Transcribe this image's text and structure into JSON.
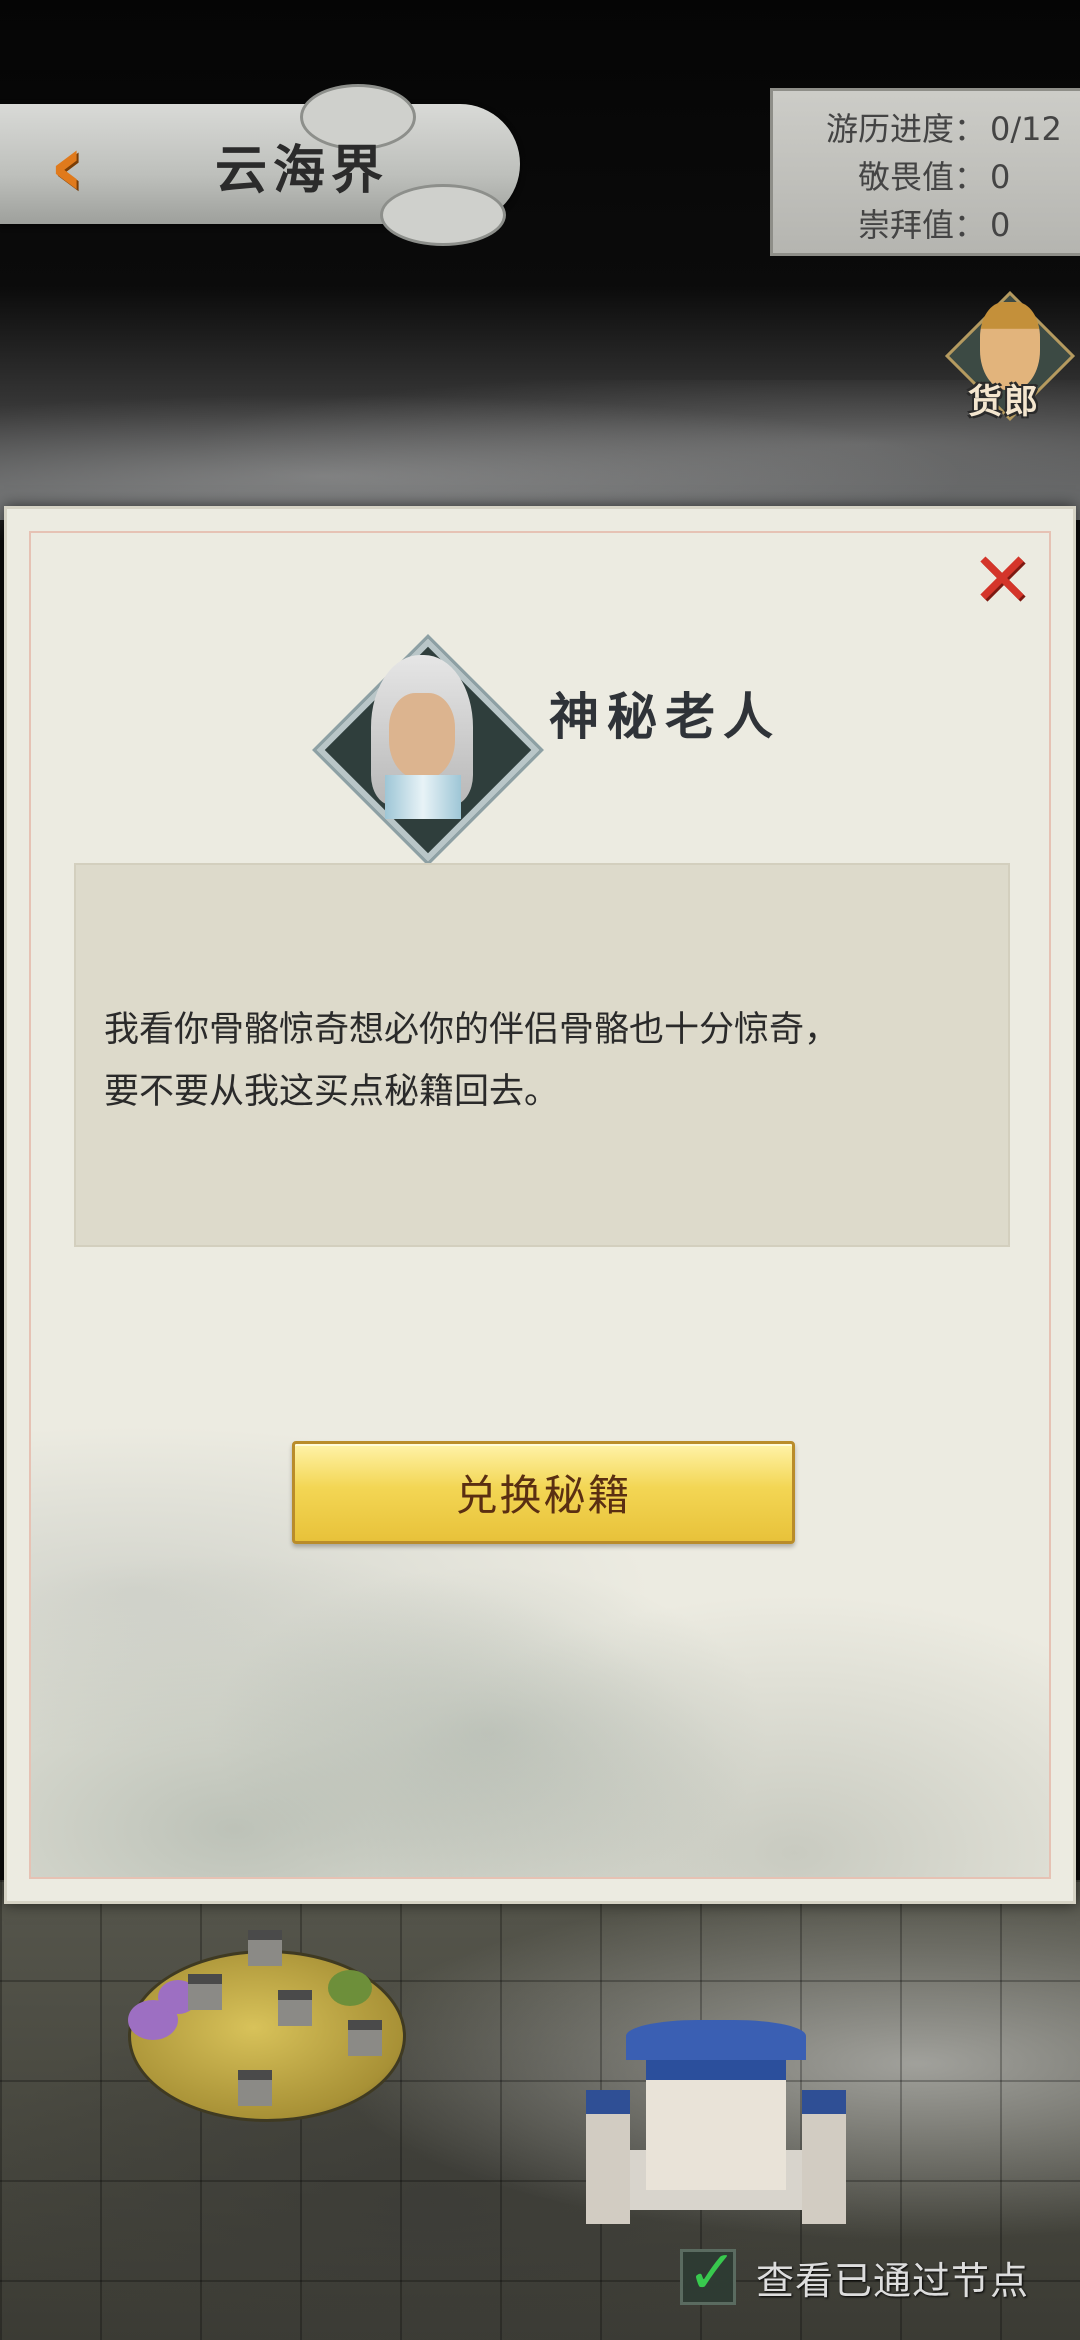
{
  "header": {
    "back_icon": "chevron-left-icon",
    "region_title": "云海界"
  },
  "stats": {
    "progress_label": "游历进度：",
    "progress_value": "0/12",
    "awe_label": "敬畏值：",
    "awe_value": "0",
    "worship_label": "崇拜值：",
    "worship_value": "0"
  },
  "merchant": {
    "label": "货郎"
  },
  "dialog": {
    "close_icon": "close-x-icon",
    "npc_name": "神秘老人",
    "text_lines": [
      "我看你骨骼惊奇想必你的伴侣骨骼也十分惊奇，",
      "要不要从我这买点秘籍回去。"
    ],
    "exchange_button": "兑换秘籍"
  },
  "footer": {
    "check_icon": "checkmark-icon",
    "passed_nodes_label": "查看已通过节点"
  },
  "colors": {
    "close_red": "#d4352a",
    "button_gold": "#f3d654",
    "back_orange": "#e07a1c",
    "check_green": "#38c94e"
  }
}
